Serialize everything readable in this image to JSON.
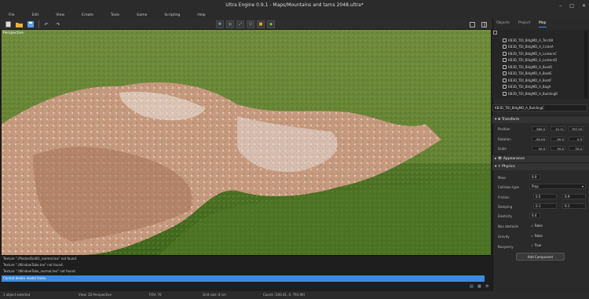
{
  "window": {
    "title": "Ultra Engine 0.9.1 - Maps/Mountains and tarns 2048.ultra*",
    "controls": [
      "–",
      "□",
      "✕"
    ]
  },
  "menu": [
    "File",
    "Edit",
    "View",
    "Create",
    "Tools",
    "Game",
    "Scripting",
    "Help"
  ],
  "viewport": {
    "label": "Perspective"
  },
  "console": {
    "lines": [
      "Texture \"./PlasterDoll01_normal.tex\" not found.",
      "Texture \"./WindowTube.tex\" not found.",
      "Texture \"./WindowTube_normal.tex\" not found."
    ],
    "input": "Cannot delete model limbs."
  },
  "status": {
    "selected": "1 object selected",
    "view": "View: 3D Perspective",
    "fov": "FOV: 70",
    "gridsize": "Grid size: 8 cm",
    "coords": "Coord: (100.41, 0, 793.90)"
  },
  "panel": {
    "tabs": [
      "Objects",
      "Project",
      "Map"
    ],
    "tree": [
      "KB3D_TDI_BldgMD_A_TorchB",
      "KB3D_TDI_BldgMD_A_CrateA",
      "KB3D_TDI_BldgMD_A_LanternC",
      "KB3D_TDI_BldgMD_A_LanternD",
      "KB3D_TDI_BldgMD_A_BoatD",
      "KB3D_TDI_BldgMD_A_BoatE",
      "KB3D_TDI_BldgMD_A_BoatF",
      "KB3D_TDI_BldgMD_A_BagA",
      "KB3D_TDI_BldgMD_A_BuildingB"
    ],
    "name": "KB3D_TDI_BldgMD_A_BuildingC",
    "transform": {
      "title": "Transform",
      "position_label": "Position",
      "position": [
        "560.0",
        "12.11",
        "797.29"
      ],
      "rotation_label": "Rotation",
      "rotation": [
        "-90.00",
        "-90.0",
        "0.0"
      ],
      "scale_label": "Scale",
      "scale": [
        "50.0",
        "50.0",
        "50.0"
      ]
    },
    "appearance": {
      "title": "Appearance"
    },
    "physics": {
      "title": "Physics",
      "mass_label": "Mass",
      "mass": "0.0",
      "collision_label": "Collision type",
      "collision": "Prop",
      "friction_label": "Friction",
      "friction": [
        "0.5",
        "0.9"
      ],
      "damping_label": "Damping",
      "damping": [
        "0.1",
        "0.1"
      ],
      "elasticity_label": "Elasticity",
      "elasticity": "0.4",
      "navobstacle_label": "Nav obstacle",
      "navobstacle": "False",
      "gravity_label": "Gravity",
      "gravity": "False",
      "buoyancy_label": "Buoyancy",
      "buoyancy": "True"
    },
    "add_component": "Add Component"
  }
}
